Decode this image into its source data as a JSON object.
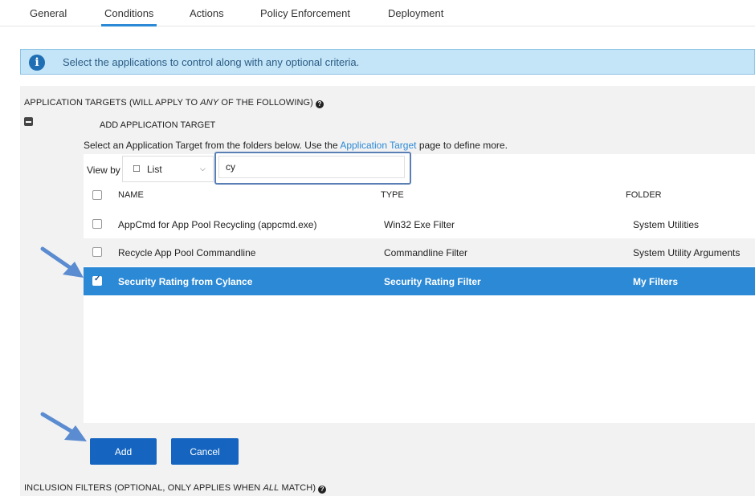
{
  "tabs": [
    {
      "label": "General"
    },
    {
      "label": "Conditions"
    },
    {
      "label": "Actions"
    },
    {
      "label": "Policy Enforcement"
    },
    {
      "label": "Deployment"
    }
  ],
  "info": {
    "text": "Select the applications to control along with any optional criteria."
  },
  "targets_header": {
    "prefix": "APPLICATION TARGETS (WILL APPLY TO ",
    "emph": "ANY",
    "suffix": " OF THE FOLLOWING)"
  },
  "add_target": {
    "title": "ADD APPLICATION TARGET"
  },
  "instructions": {
    "before": "Select an Application Target from the folders below. Use the ",
    "link": "Application Target",
    "after": " page to define more."
  },
  "view_by": {
    "label": "View by",
    "glyph": "☐",
    "value": "List"
  },
  "search": {
    "value": "cy"
  },
  "columns": {
    "name": "NAME",
    "type": "TYPE",
    "folder": "FOLDER"
  },
  "rows": [
    {
      "name": "AppCmd for App Pool Recycling (appcmd.exe)",
      "type": "Win32 Exe Filter",
      "folder": "System Utilities",
      "checked": false
    },
    {
      "name": "Recycle App Pool Commandline",
      "type": "Commandline Filter",
      "folder": "System Utility Arguments",
      "checked": false
    },
    {
      "name": "Security Rating from Cylance",
      "type": "Security Rating Filter",
      "folder": "My Filters",
      "checked": true
    }
  ],
  "buttons": {
    "add": "Add",
    "cancel": "Cancel"
  },
  "inclusion_header": {
    "prefix": "INCLUSION FILTERS (OPTIONAL, ONLY APPLIES WHEN ",
    "emph": "ALL",
    "suffix": " MATCH)"
  },
  "colors": {
    "accent": "#2b89d6",
    "button": "#1565c0",
    "info_bg": "#c4e4f7",
    "arrow": "#5b8bd0"
  }
}
